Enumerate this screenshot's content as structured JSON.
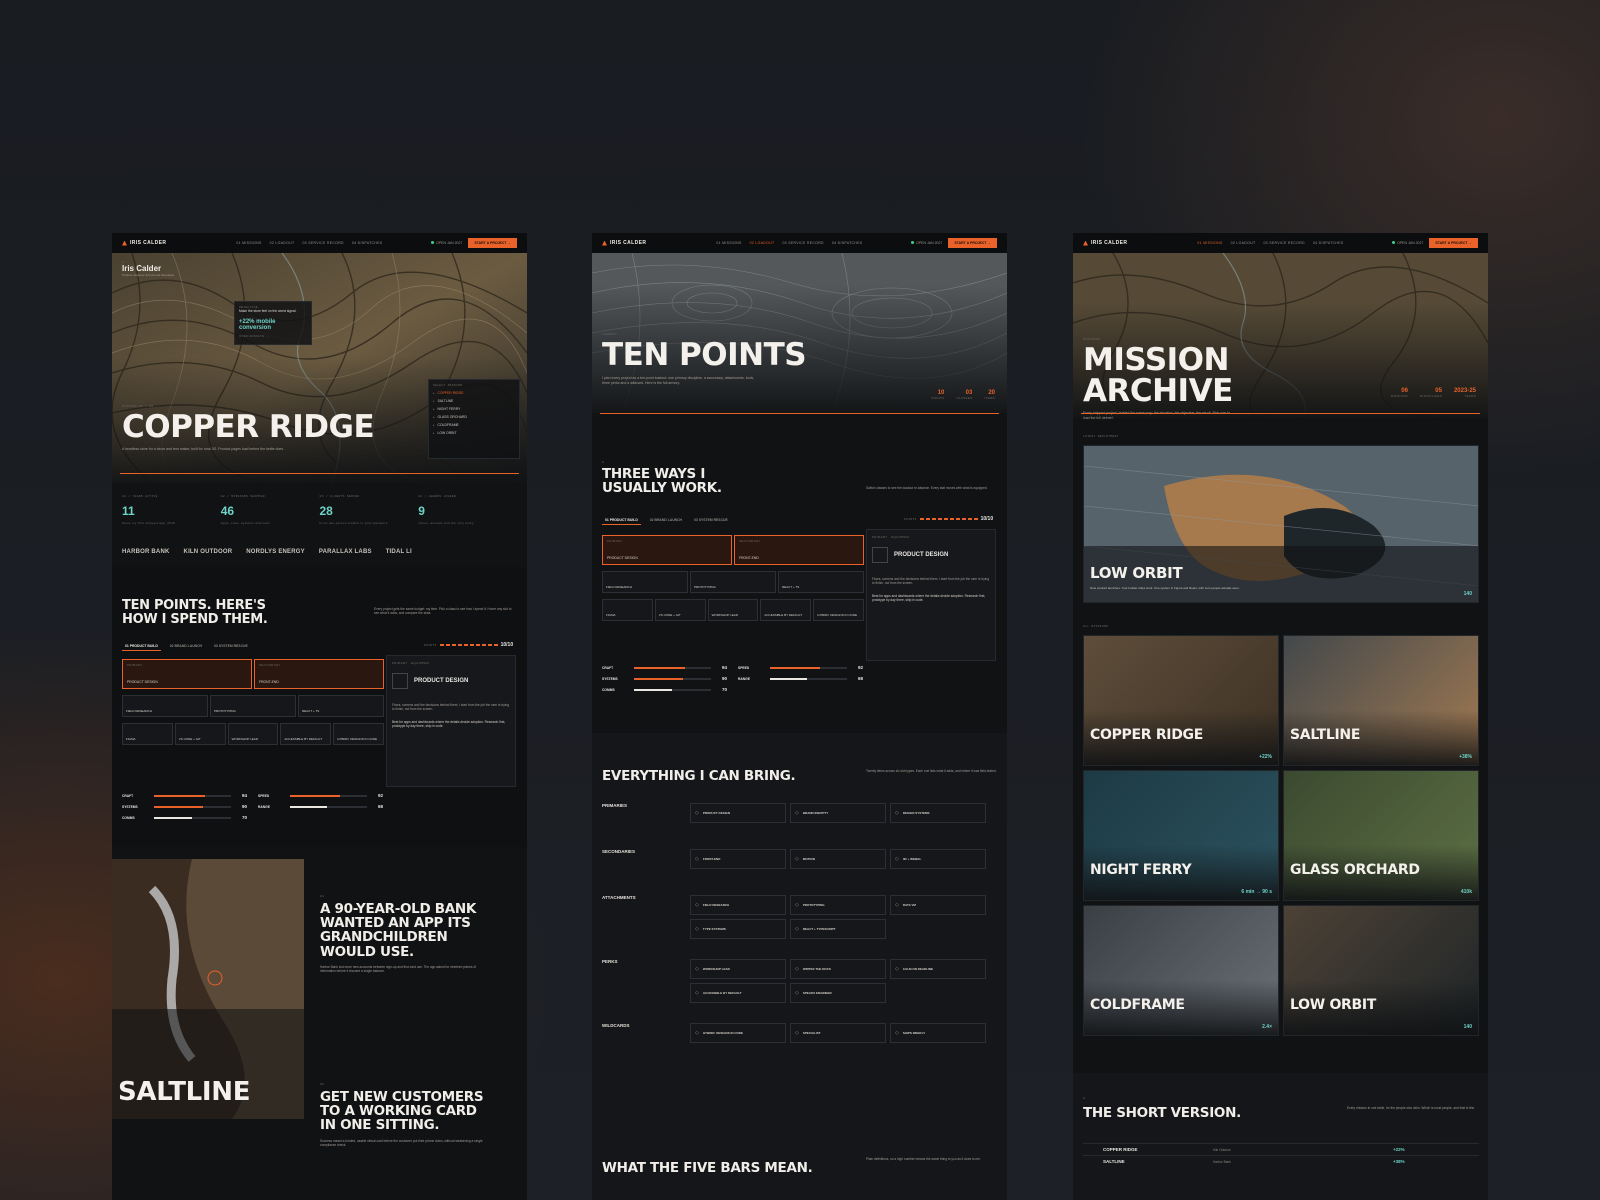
{
  "brand": "IRIS CALDER",
  "nav_links": [
    "01 MISSIONS",
    "02 LOADOUT",
    "03 SERVICE RECORD",
    "04 DISPATCHES"
  ],
  "nav_status": "OPEN JAN 2027",
  "cta": "START A PROJECT →",
  "colors": {
    "accent": "#e8622a",
    "teal": "#6fd3c8",
    "bg": "#101214"
  },
  "s1": {
    "owner": "Iris Calder",
    "owner_sub": "Product designer & front-end developer",
    "tooltip_kicker": "OBJECTIVE",
    "tooltip_line": "Make the store feel on the worst signal.",
    "tooltip_result": "+22% mobile conversion",
    "tooltip_link": "OPEN MISSION →",
    "mission_tag": "MISSION 01 / 06",
    "hero_title": "COPPER RIDGE",
    "hero_desc": "A headless store for a stove and tent maker, built for rural 3G. Product pages load before the kettle does.",
    "select_head": "SELECT MISSION",
    "select_items": [
      "COPPER RIDGE",
      "SALTLINE",
      "NIGHT FERRY",
      "GLASS ORCHARD",
      "COLDFRAME",
      "LOW ORBIT"
    ],
    "stats": [
      {
        "k": "01 / YEARS ACTIVE",
        "v": "11",
        "d": "Since my first shipped app, 2015"
      },
      {
        "k": "02 / MISSIONS SHIPPED",
        "v": "46",
        "d": "Apps, sites, systems and tools"
      },
      {
        "k": "03 / CLIENTS SERVED",
        "v": "28",
        "d": "From two-person studios to grid operators"
      },
      {
        "k": "04 / AWARDS LOGGED",
        "v": "9",
        "d": "Juries, annuals and the very lucky"
      }
    ],
    "clients": [
      "HARBOR BANK",
      "KILN OUTDOOR",
      "NORDLYS ENERGY",
      "PARALLAX LABS",
      "TIDAL LI"
    ],
    "ten_title": "TEN POINTS. HERE'S HOW I SPEND THEM.",
    "ten_desc": "Every project gets the same budget: my time. Pick a class to see how I spend it. Hover any slot to see what it adds, and compare the stats.",
    "classes": [
      "01 PRODUCT BUILD",
      "02 BRAND LAUNCH",
      "03 SYSTEM RESCUE"
    ],
    "points": "10/10",
    "primary": [
      "PRODUCT DESIGN",
      "FRONT-END"
    ],
    "attach": [
      "FIELD RESEARCH",
      "PROTOTYPING",
      "REACT + TS"
    ],
    "perks": [
      "FIGMA",
      "VS CODE + GIT",
      "WORKSHOP LEAD",
      "ACCESSIBLE BY DEFAULT",
      "HYBRID: DESIGNS IN CODE"
    ],
    "side_card_title": "PRODUCT DESIGN",
    "side_card_desc": "Flows, screens and the decisions behind them. I start from the job the user is trying to finish, not from the screen.",
    "side_card_best": "Best for apps and dashboards where the details decide adoption. Research first, prototype by day three, ship in code.",
    "bars": [
      {
        "n": "CRAFT",
        "v": 94
      },
      {
        "n": "SYSTEMS",
        "v": 90
      },
      {
        "n": "COMMS",
        "v": 70
      },
      {
        "n": "SPEED",
        "v": 92
      },
      {
        "n": "RANGE",
        "v": 68
      }
    ],
    "case1_num": "01",
    "case1_title": "A 90-YEAR-OLD BANK WANTED AN APP ITS GRANDCHILDREN WOULD USE.",
    "case1_desc": "Harbor Bank lost more new accounts between sign-up and first card use. The app asked for nineteen pieces of information before it showed a single balance.",
    "case2_num": "02",
    "case2_title": "GET NEW CUSTOMERS TO A WORKING CARD IN ONE SITTING.",
    "case2_desc": "Success meant a funded, usable virtual card before the customer put their phone down, without weakening a single compliance check.",
    "saltline": "SALTLINE"
  },
  "s2": {
    "kicker": "LOADOUT",
    "title": "TEN POINTS",
    "desc": "I plan every project as a ten-point loadout: one primary discipline, a secondary, attachments, tools, three perks and a wildcard. Here is the full armory.",
    "nums": [
      {
        "v": "10",
        "k": "POINTS"
      },
      {
        "v": "03",
        "k": "CLASSES"
      },
      {
        "v": "20",
        "k": "ITEMS"
      }
    ],
    "ways_title": "THREE WAYS I USUALLY WORK.",
    "ways_desc": "Switch classes to see the loadout re-balance. Every stat moves with what is equipped.",
    "points": "10/10",
    "bring_title": "EVERYTHING I CAN BRING.",
    "bring_desc": "Twenty items across six slot types. Each one lists what it adds, and where it was field-tested.",
    "rows": [
      {
        "cat": "PRIMARIES",
        "items": [
          "PRODUCT DESIGN",
          "BRAND IDENTITY",
          "DESIGN SYSTEMS"
        ]
      },
      {
        "cat": "SECONDARIES",
        "items": [
          "FRONT-END",
          "MOTION",
          "3D + WEBGL"
        ]
      },
      {
        "cat": "ATTACHMENTS",
        "items": [
          "FIELD RESEARCH",
          "PROTOTYPING",
          "DATA VIZ",
          "TYPE SYSTEMS",
          "REACT + TYPESCRIPT"
        ]
      },
      {
        "cat": "PERKS",
        "items": [
          "WORKSHOP LEAD",
          "WRITES THE DOCS",
          "CALM ON DEADLINE",
          "ACCESSIBLE BY DEFAULT",
          "SPEAKS ENGINEER"
        ]
      },
      {
        "cat": "WILDCARDS",
        "items": [
          "HYBRID: DESIGNS IN CODE",
          "SPECIALIST",
          "SHIPS WEEKLY"
        ]
      }
    ],
    "five_title": "WHAT THE FIVE BARS MEAN.",
    "five_desc": "Plain definitions, so a high number means the same thing to you as it does to me."
  },
  "s3": {
    "kicker": "MISSIONS",
    "title": "MISSION ARCHIVE",
    "desc": "Every shipped project, briefed the same way: the situation, the objective, the result. Pick one to load the full debrief.",
    "nums": [
      {
        "v": "06",
        "k": "MISSIONS"
      },
      {
        "v": "05",
        "k": "DISCIPLINES"
      },
      {
        "v": "2023-25",
        "k": "YEARS"
      }
    ],
    "latest": "LATEST DEPLOYMENT",
    "feature": {
      "title": "LOW ORBIT",
      "sub": "Nine product launches. Your builder ships work. One system in Figma and React, with zero people actually seen.",
      "kpi": "140"
    },
    "all": "ALL MISSIONS",
    "tiles": [
      {
        "title": "COPPER RIDGE",
        "kpi": "+22%"
      },
      {
        "title": "SALTLINE",
        "kpi": "+38%"
      },
      {
        "title": "NIGHT FERRY",
        "kpi": "6 min → 90 s"
      },
      {
        "title": "GLASS ORCHARD",
        "kpi": "410k"
      },
      {
        "title": "COLDFRAME",
        "kpi": "2.4×"
      },
      {
        "title": "LOW ORBIT",
        "kpi": "140"
      }
    ],
    "short_title": "THE SHORT VERSION.",
    "short_desc": "Every mission in one table, for the people who skim. Which is most people, and that is fine.",
    "table": [
      {
        "name": "COPPER RIDGE",
        "client": "Kiln Outdoor",
        "kpi": "+22%"
      },
      {
        "name": "SALTLINE",
        "client": "Harbor Bank",
        "kpi": "+38%"
      }
    ]
  }
}
